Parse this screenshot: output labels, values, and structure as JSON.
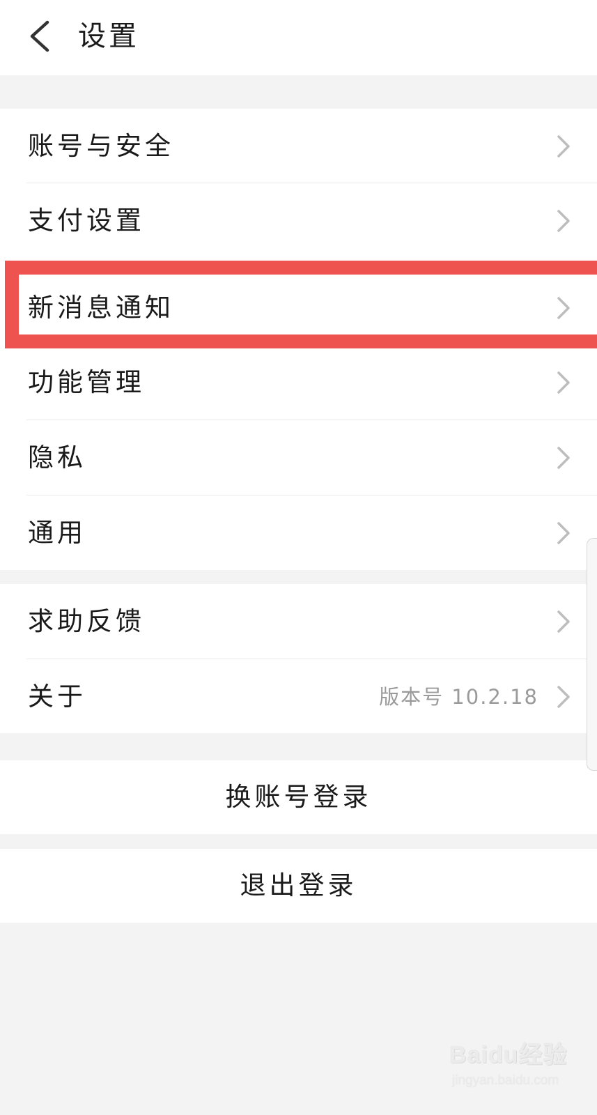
{
  "header": {
    "title": "设置",
    "back_icon": "chevron-left-icon"
  },
  "settings": {
    "account_security": "账号与安全",
    "payment_settings": "支付设置",
    "new_message_notifications": "新消息通知",
    "feature_management": "功能管理",
    "privacy": "隐私",
    "general": "通用",
    "help_feedback": "求助反馈",
    "about": "关于",
    "about_version": "版本号 10.2.18"
  },
  "actions": {
    "switch_account": "换账号登录",
    "log_out": "退出登录"
  },
  "annotation": {
    "highlight_color": "#ef5350"
  },
  "watermark": {
    "logo": "Baidu经验",
    "url": "jingyan.baidu.com"
  },
  "colors": {
    "background": "#f3f3f3",
    "surface": "#ffffff",
    "chevron": "#bdbdbd",
    "secondary_text": "#9a9a9a"
  }
}
